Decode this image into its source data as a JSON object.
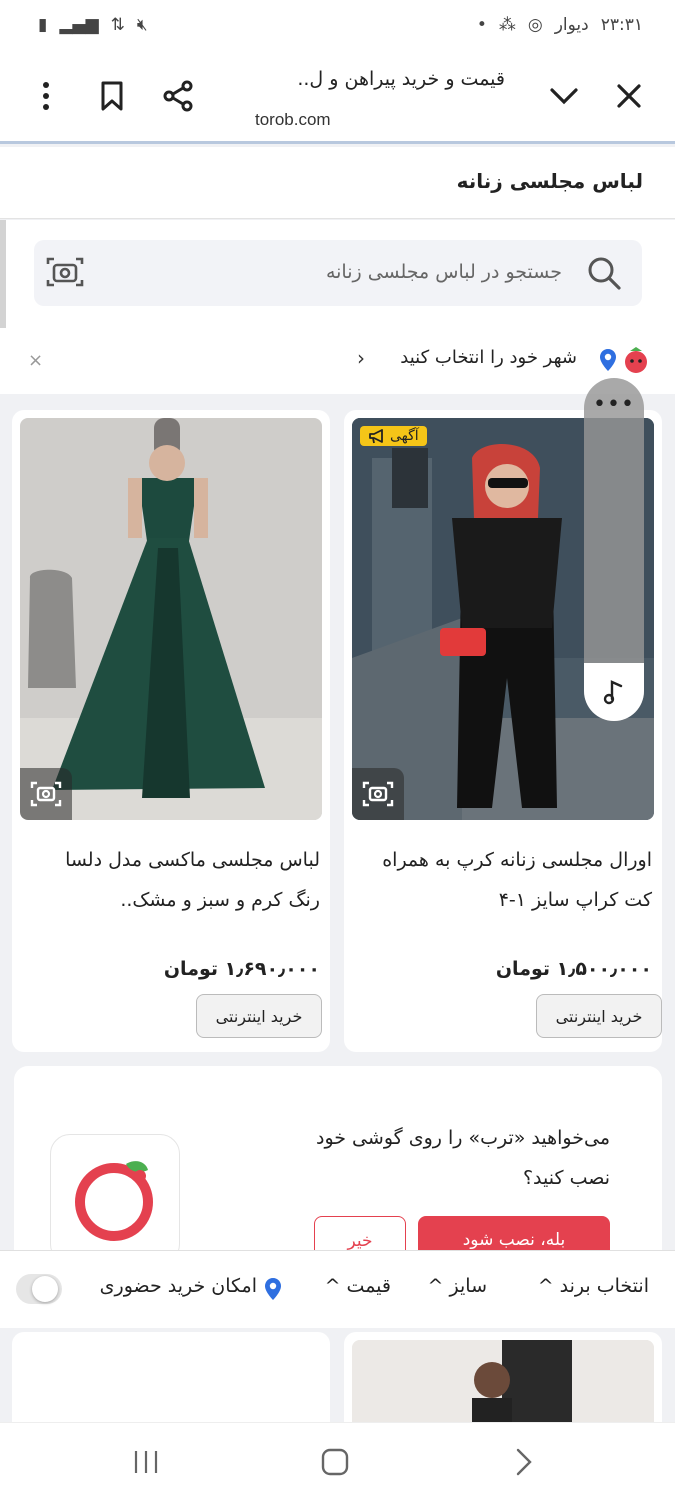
{
  "status_bar": {
    "time": "۲۳:۳۱",
    "app_label": "دیوار"
  },
  "browser": {
    "page_title": "قیمت و خرید پیراهن و ل..",
    "url": "torob.com"
  },
  "page": {
    "heading": "لباس مجلسی زنانه"
  },
  "search": {
    "placeholder": "جستجو در لباس مجلسی زنانه"
  },
  "city": {
    "label": "شهر خود را انتخاب کنید",
    "close": "×",
    "chevron": "›"
  },
  "products": [
    {
      "title": "اورال مجلسی زنانه کرپ به همراه کت کراپ سایز ۱-۴",
      "price": "۱٫۵۰۰٫۰۰۰ تومان",
      "button": "خرید اینترنتی",
      "badge": "آگهی",
      "image_subject": "woman-black-jumpsuit-red-scarf"
    },
    {
      "title": "لباس مجلسی ماکسی مدل دلسا رنگ کرم و سبز و مشک..",
      "price": "۱٫۶۹۰٫۰۰۰ تومان",
      "button": "خرید اینترنتی",
      "image_subject": "dark-green-satin-evening-gown"
    }
  ],
  "floating_panel": {
    "dots": "•••"
  },
  "install_banner": {
    "text": "می‌خواهید «ترب» را روی گوشی خود نصب کنید؟",
    "yes_button": "بله، نصب شود",
    "no_button": "خیر"
  },
  "filters": [
    {
      "label": "انتخاب برند",
      "chevron": "^"
    },
    {
      "label": "سایز",
      "chevron": "^"
    },
    {
      "label": "قیمت",
      "chevron": "^"
    },
    {
      "label": "امکان خرید حضوری"
    }
  ],
  "colors": {
    "accent_red": "#e4414f",
    "badge_yellow": "#f5c518",
    "pin_blue": "#2f6fe0"
  }
}
